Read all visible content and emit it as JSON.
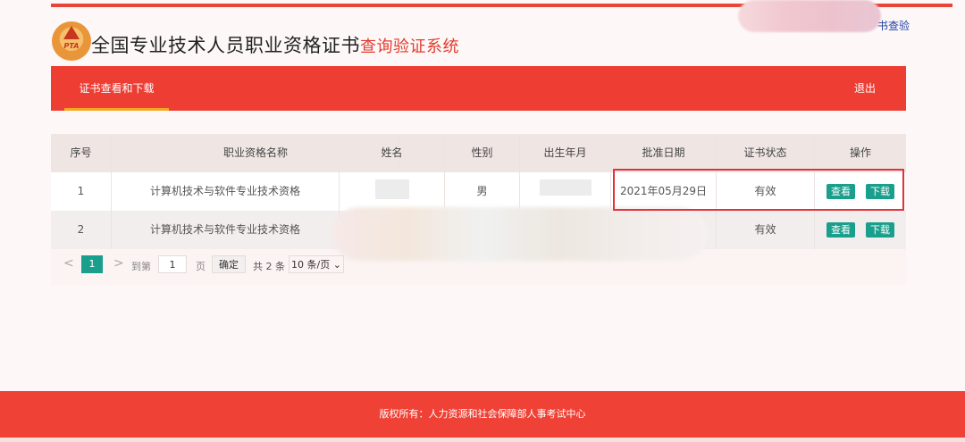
{
  "header": {
    "title_main": "全国专业技术人员职业资格证书",
    "title_accent": "查询验证系统",
    "logo_text": "PTA",
    "top_link": "书查验"
  },
  "nav": {
    "tab": "证书查看和下载",
    "logout": "退出"
  },
  "table": {
    "columns": [
      "序号",
      "职业资格名称",
      "姓名",
      "性别",
      "出生年月",
      "批准日期",
      "证书状态",
      "操作"
    ],
    "rows": [
      {
        "index": "1",
        "name": "计算机技术与软件专业技术资格",
        "person": "",
        "gender": "男",
        "birth": "",
        "date": "2021年05月29日",
        "status": "有效",
        "view": "查看",
        "download": "下载"
      },
      {
        "index": "2",
        "name": "计算机技术与软件专业技术资格",
        "person": "",
        "gender": "",
        "birth": "",
        "date": "",
        "status": "有效",
        "view": "查看",
        "download": "下载"
      }
    ]
  },
  "pager": {
    "prev": "<",
    "current": "1",
    "next": ">",
    "goto_label": "到第",
    "goto_value": "1",
    "page_unit": "页",
    "confirm": "确定",
    "total": "共 2 条",
    "per_page": "10 条/页"
  },
  "footer": {
    "copyright": "版权所有：人力资源和社会保障部人事考试中心"
  },
  "colors": {
    "brand_red": "#ee3e34",
    "action_green": "#1a9f8c",
    "highlight_red": "#e4313a"
  }
}
